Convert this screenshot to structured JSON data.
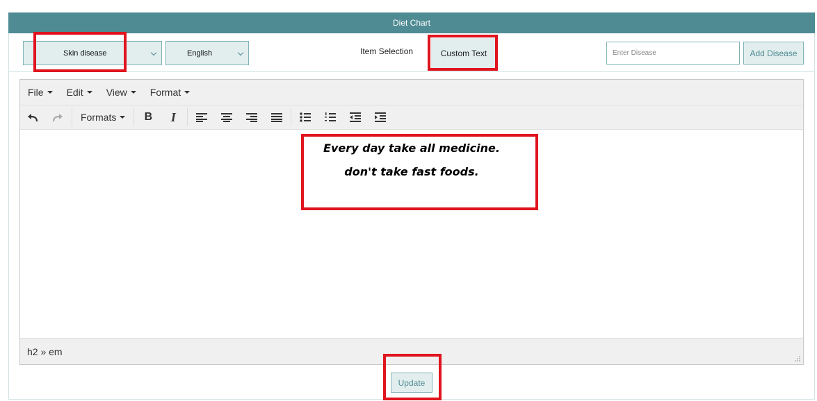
{
  "header": {
    "title": "Diet Chart"
  },
  "controls": {
    "disease_select": "Skin disease",
    "language_select": "English",
    "item_selection_label": "Item Selection",
    "custom_text_tab": "Custom Text",
    "disease_input_placeholder": "Enter Disease",
    "add_disease_button": "Add Disease"
  },
  "editor": {
    "menu": [
      "File",
      "Edit",
      "View",
      "Format"
    ],
    "formats_label": "Formats",
    "content": [
      "Every day take all medicine.",
      "don't take fast foods."
    ],
    "status_path": "h2 » em"
  },
  "update_button": "Update",
  "colors": {
    "header": "#4f8b93",
    "highlight": "#e0141e"
  }
}
